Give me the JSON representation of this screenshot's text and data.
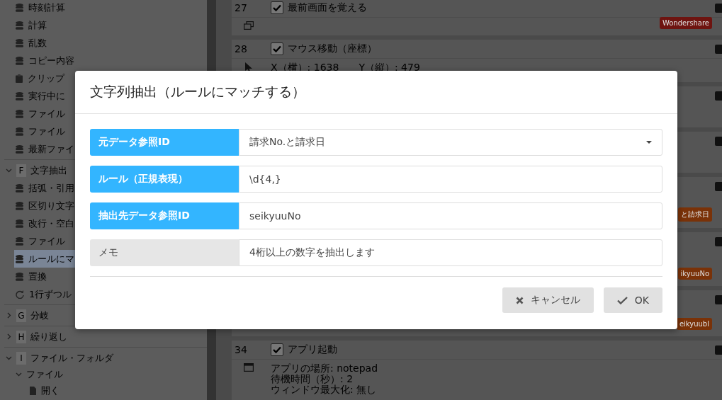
{
  "sidebar": {
    "items": [
      {
        "kind": "data",
        "label": "時刻計算",
        "selected": false
      },
      {
        "kind": "data",
        "label": "計算",
        "selected": false
      },
      {
        "kind": "data",
        "label": "乱数",
        "selected": false
      },
      {
        "kind": "data",
        "label": "コピー内容",
        "selected": false
      },
      {
        "kind": "clipboard",
        "label": "クリップ",
        "selected": false
      },
      {
        "kind": "data",
        "label": "実行中に",
        "selected": false
      },
      {
        "kind": "data",
        "label": "ファイル",
        "selected": false
      },
      {
        "kind": "data",
        "label": "ファイル",
        "selected": false
      },
      {
        "kind": "data",
        "label": "最新ファイ",
        "selected": false
      }
    ],
    "groups": [
      {
        "letter": "F",
        "label": "文字抽出",
        "expanded": true,
        "children": [
          {
            "kind": "data",
            "label": "括弧・引用",
            "selected": false
          },
          {
            "kind": "data",
            "label": "区切り文字",
            "selected": false
          },
          {
            "kind": "data",
            "label": "改行・空白",
            "selected": false
          },
          {
            "kind": "data",
            "label": "ファイル",
            "selected": false
          },
          {
            "kind": "data",
            "label": "ルールにマ",
            "selected": true
          },
          {
            "kind": "data",
            "label": "置換",
            "selected": false
          },
          {
            "kind": "loop",
            "label": "1行ずつル",
            "selected": false
          }
        ]
      },
      {
        "letter": "G",
        "label": "分岐",
        "expanded": false
      },
      {
        "letter": "H",
        "label": "繰り返し",
        "expanded": false
      },
      {
        "letter": "I",
        "label": "ファイル・フォルダ",
        "expanded": true,
        "subgroups": [
          {
            "label": "ファイル",
            "expanded": true,
            "children": [
              {
                "kind": "file",
                "label": "開く",
                "selected": false
              }
            ]
          }
        ]
      }
    ]
  },
  "steps": [
    {
      "number": "27",
      "checked": true,
      "title": "最前画面を覚える",
      "kind": "window",
      "badge": "Wondershare",
      "color": "#6e1410"
    },
    {
      "number": "28",
      "checked": true,
      "title": "マウス移動（座標）",
      "kind": "pointer",
      "details": [
        "X（横）: 1638　　Y（縦）: 479"
      ]
    },
    {
      "kind": "hidden"
    },
    {
      "kind": "hidden"
    },
    {
      "kind": "hidden",
      "badge": "と請求日",
      "color": "#7a3208"
    },
    {
      "kind": "hidden",
      "badge": "ikyuuNo",
      "color": "#7a3208"
    },
    {
      "kind": "hidden",
      "badge": "eikyuubl",
      "color": "#7a3208"
    },
    {
      "number": "34",
      "checked": true,
      "title": "アプリ起動",
      "kind": "app",
      "details": [
        "アプリの場所: notepad",
        "待機時間（秒）: 2",
        "ウィンドウ最大化: 無し"
      ]
    }
  ],
  "dialog": {
    "title": "文字列抽出（ルールにマッチする）",
    "fields": [
      {
        "label": "元データ参照ID",
        "required": true,
        "kind": "select",
        "value": "請求No.と請求日"
      },
      {
        "label": "ルール（正規表現）",
        "required": true,
        "kind": "input",
        "value": "\\d{4,}"
      },
      {
        "label": "抽出先データ参照ID",
        "required": true,
        "kind": "input",
        "value": "seikyuuNo"
      },
      {
        "label": "メモ",
        "required": false,
        "kind": "input",
        "value": "4桁以上の数字を抽出します"
      }
    ],
    "buttons": [
      {
        "kind": "cancel",
        "label": "キャンセル"
      },
      {
        "kind": "ok",
        "label": "OK"
      }
    ]
  }
}
